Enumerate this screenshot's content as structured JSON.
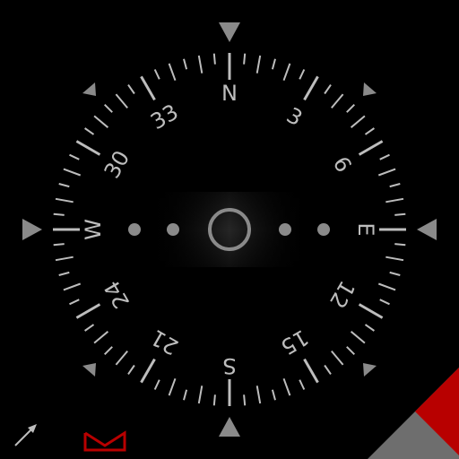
{
  "compass": {
    "cardinals": {
      "north": "N",
      "east": "E",
      "south": "S",
      "west": "W"
    },
    "degree_labels": [
      {
        "bearing": 30,
        "text": "3"
      },
      {
        "bearing": 60,
        "text": "6"
      },
      {
        "bearing": 120,
        "text": "12"
      },
      {
        "bearing": 150,
        "text": "15"
      },
      {
        "bearing": 210,
        "text": "21"
      },
      {
        "bearing": 240,
        "text": "24"
      },
      {
        "bearing": 300,
        "text": "30"
      },
      {
        "bearing": 330,
        "text": "33"
      }
    ],
    "heading_deg": 0
  },
  "colors": {
    "background": "#000000",
    "dial": "#bdbdbd",
    "marker": "#8a8a8a",
    "accent_red": "#b80000",
    "corner_grey": "#6e6e6e"
  },
  "icons": {
    "bottom_left": "pointer-arrow-icon",
    "bookmark": "crown-bookmark-icon"
  }
}
